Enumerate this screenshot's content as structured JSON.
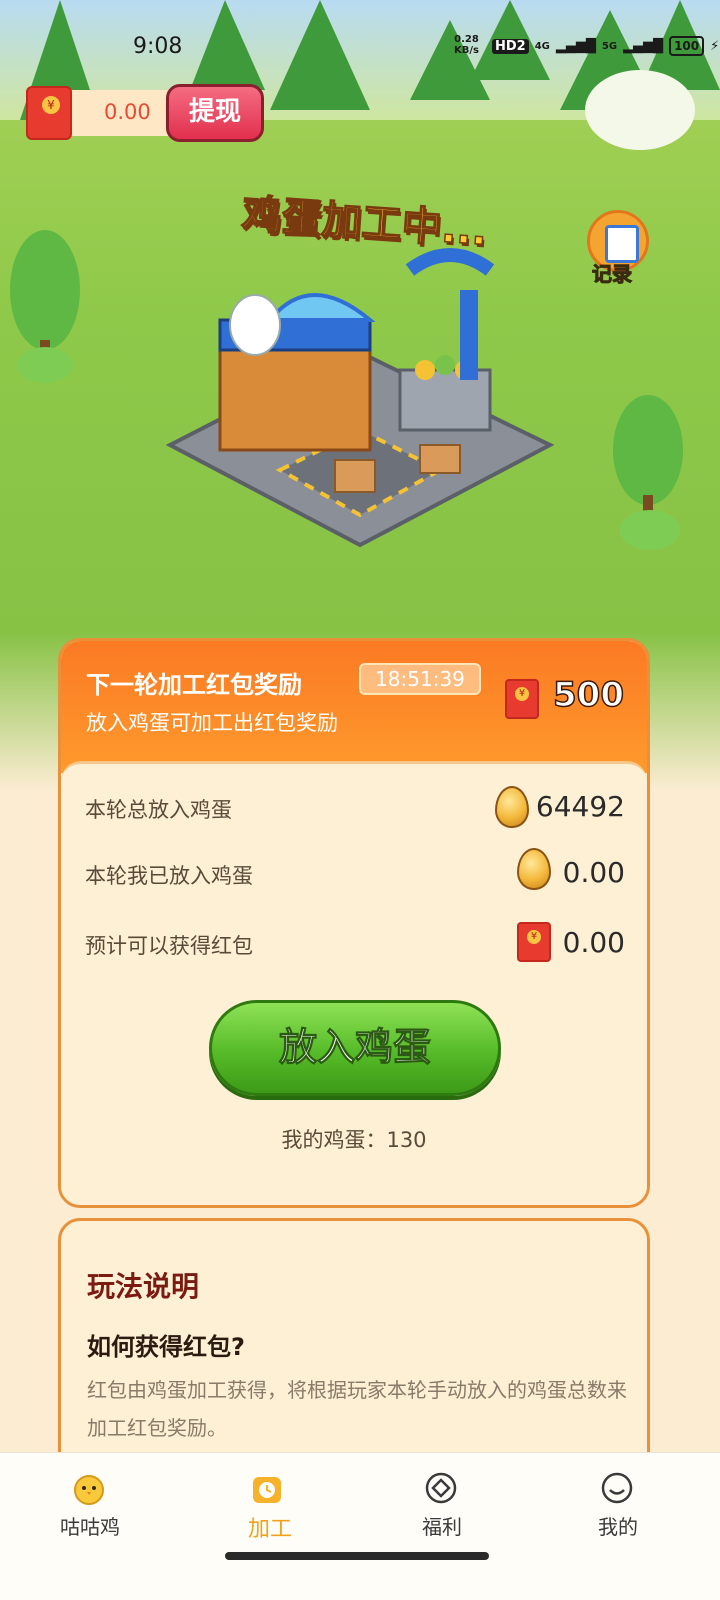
{
  "status_bar": {
    "time": "9:08",
    "network_speed": "0.28\nKB/s",
    "hd_label": "HD2",
    "net_4g": "4G",
    "net_5g": "5G",
    "battery": "100"
  },
  "wallet": {
    "amount": "0.00",
    "withdraw_label": "提现"
  },
  "scene": {
    "title": "鸡蛋加工中...",
    "record_label": "记录"
  },
  "reward": {
    "title": "下一轮加工红包奖励",
    "countdown": "18:51:39",
    "subtitle": "放入鸡蛋可加工出红包奖励",
    "amount": "500"
  },
  "stats": [
    {
      "label": "本轮总放入鸡蛋",
      "value": "64492",
      "icon": "egg-icon"
    },
    {
      "label": "本轮我已放入鸡蛋",
      "value": "0.00",
      "icon": "egg-icon"
    },
    {
      "label": "预计可以获得红包",
      "value": "0.00",
      "icon": "red-envelope-icon"
    }
  ],
  "action": {
    "button_label": "放入鸡蛋",
    "my_eggs": "我的鸡蛋：130"
  },
  "rules": {
    "title": "玩法说明",
    "question": "如何获得红包?",
    "text": "红包由鸡蛋加工获得，将根据玩家本轮手动放入的鸡蛋总数来加工红包奖励。"
  },
  "tabs": [
    {
      "label": "咕咕鸡",
      "icon": "chick-icon",
      "active": false
    },
    {
      "label": "加工",
      "icon": "process-icon",
      "active": true
    },
    {
      "label": "福利",
      "icon": "welfare-icon",
      "active": false
    },
    {
      "label": "我的",
      "icon": "smile-icon",
      "active": false
    }
  ],
  "colors": {
    "accent_orange": "#fb7a24",
    "button_green": "#56bb28",
    "active_tab": "#f0a21c",
    "red_envelope": "#e63b2e"
  }
}
